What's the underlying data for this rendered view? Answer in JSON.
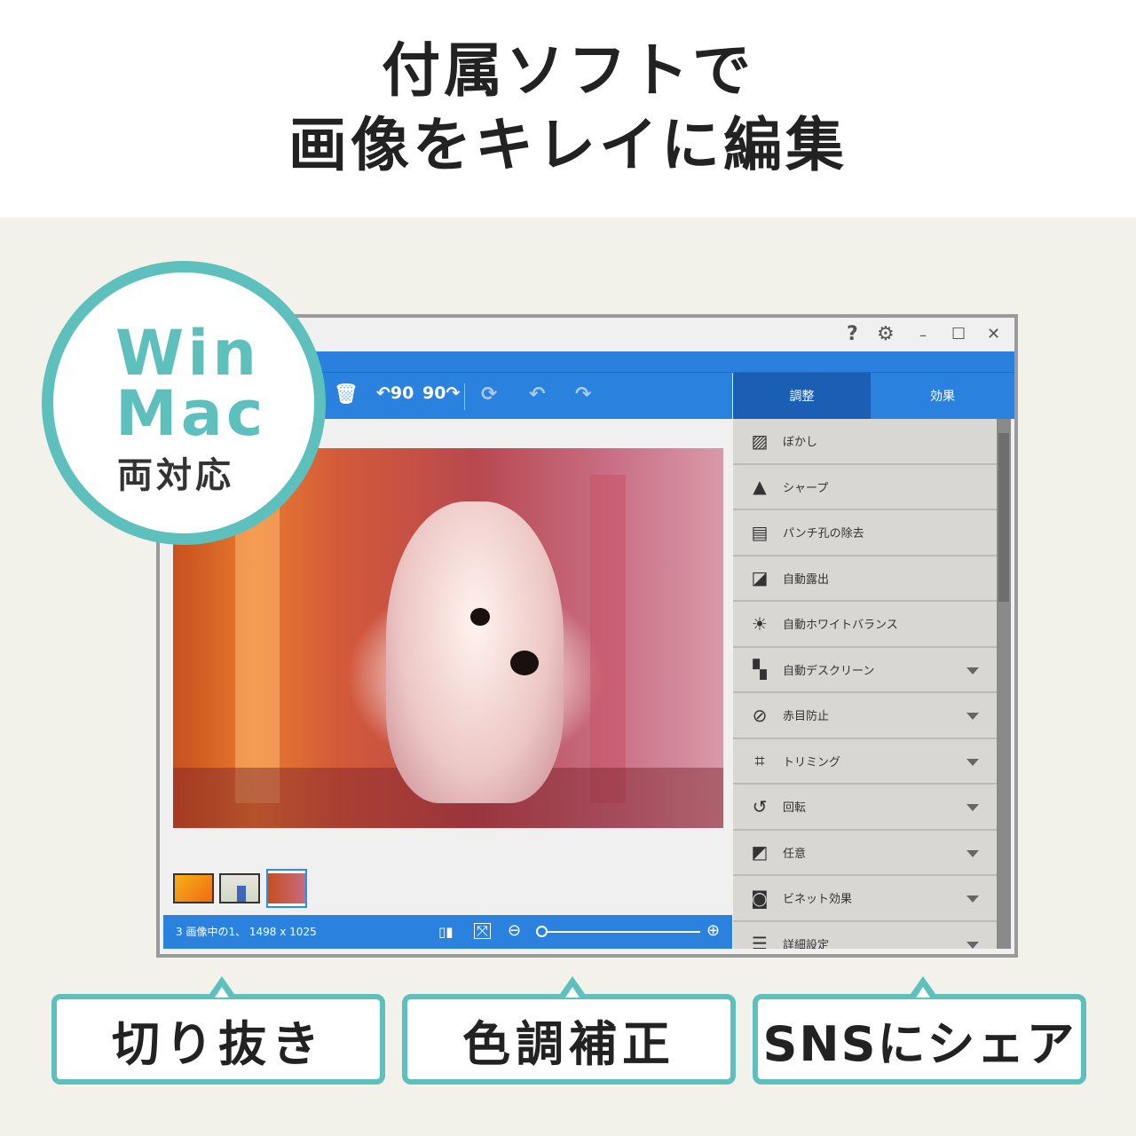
{
  "headline": {
    "line1": "付属ソフトで",
    "line2": "画像をキレイに編集"
  },
  "badge": {
    "line1": "Win",
    "line2": "Mac",
    "line3": "両対応"
  },
  "window": {
    "titlebar": {
      "help": "?",
      "settings": "⚙",
      "minimize": "–",
      "maximize": "☐",
      "close": "✕"
    },
    "toolbar": {
      "delete": "🗑",
      "rotate_left": "↶90",
      "rotate_right": "90↷",
      "refresh": "⟳",
      "undo": "↶",
      "redo": "↷"
    },
    "tabs": [
      {
        "label": "調整",
        "active": true
      },
      {
        "label": "効果",
        "active": false
      }
    ],
    "status": {
      "text": "3 画像中の1、 1498 x 1025",
      "zoom_level": 0
    },
    "adjust_items": [
      {
        "label": "ぼかし",
        "icon": "blur-icon",
        "expandable": false
      },
      {
        "label": "シャープ",
        "icon": "sharpen-icon",
        "expandable": false
      },
      {
        "label": "パンチ孔の除去",
        "icon": "punch-hole-icon",
        "expandable": false
      },
      {
        "label": "自動露出",
        "icon": "exposure-icon",
        "expandable": false
      },
      {
        "label": "自動ホワイトバランス",
        "icon": "sun-icon",
        "expandable": false
      },
      {
        "label": "自動デスクリーン",
        "icon": "descreen-icon",
        "expandable": true
      },
      {
        "label": "赤目防止",
        "icon": "red-eye-icon",
        "expandable": true
      },
      {
        "label": "トリミング",
        "icon": "crop-icon",
        "expandable": true
      },
      {
        "label": "回転",
        "icon": "rotate-icon",
        "expandable": true
      },
      {
        "label": "任意",
        "icon": "free-transform-icon",
        "expandable": true
      },
      {
        "label": "ビネット効果",
        "icon": "vignette-icon",
        "expandable": true
      },
      {
        "label": "詳細設定",
        "icon": "sliders-icon",
        "expandable": true
      }
    ],
    "thumbnails": [
      {
        "name": "flower",
        "selected": false
      },
      {
        "name": "vase",
        "selected": false
      },
      {
        "name": "dog",
        "selected": true
      }
    ]
  },
  "features": [
    "切り抜き",
    "色調補正",
    "SNSにシェア"
  ],
  "colors": {
    "accent": "#2b82de",
    "active_tab": "#1a5fb4",
    "teal": "#5ec0bd",
    "background": "#f2f2ea"
  }
}
